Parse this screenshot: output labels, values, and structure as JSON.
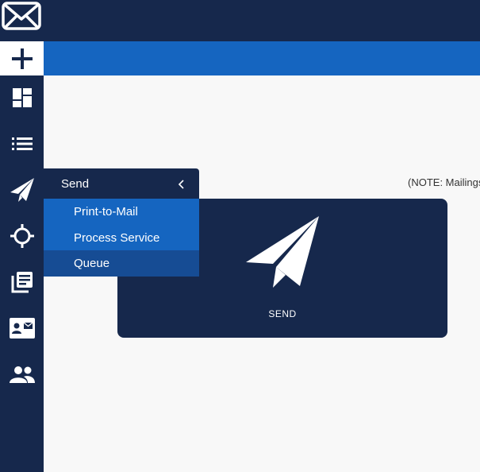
{
  "header": {
    "logo_icon": "envelope-icon"
  },
  "sidebar": {
    "add_icon": "plus-icon",
    "items": [
      {
        "id": "dashboard",
        "icon": "dashboard-icon"
      },
      {
        "id": "list",
        "icon": "list-icon"
      },
      {
        "id": "send",
        "icon": "paper-plane-icon"
      },
      {
        "id": "target",
        "icon": "crosshair-icon"
      },
      {
        "id": "library",
        "icon": "library-icon"
      },
      {
        "id": "contact",
        "icon": "contact-card-icon"
      },
      {
        "id": "people",
        "icon": "people-icon"
      }
    ]
  },
  "flyout": {
    "title": "Send",
    "items": [
      {
        "label": "Print-to-Mail"
      },
      {
        "label": "Process Service"
      },
      {
        "label": "Queue"
      }
    ]
  },
  "main": {
    "note": "(NOTE: Mailings",
    "send_card": {
      "label": "SEND"
    }
  },
  "colors": {
    "navy": "#16284c",
    "blue": "#1565c0",
    "active_blue": "#164c94",
    "background": "#f8f8f8"
  }
}
